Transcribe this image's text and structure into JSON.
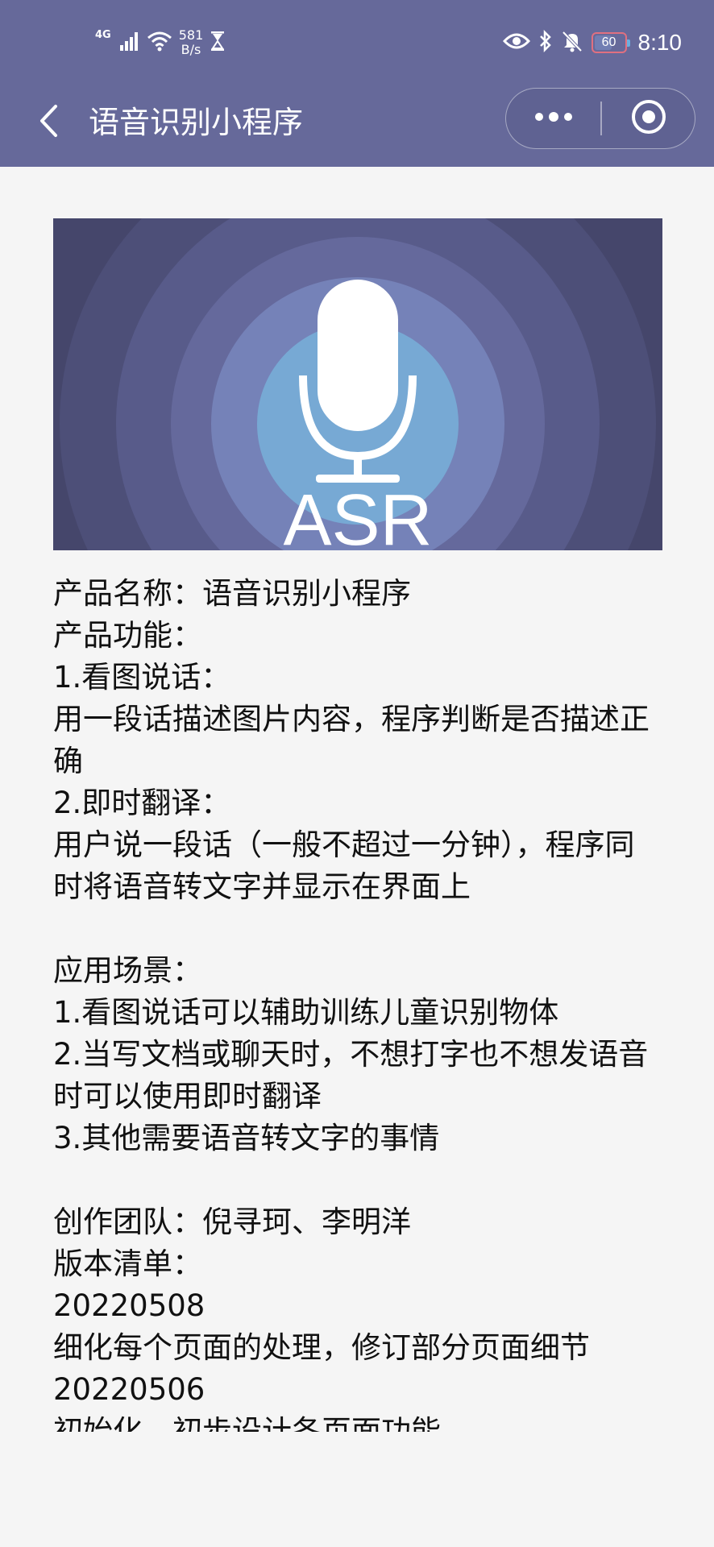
{
  "status_bar": {
    "network_type": "4G",
    "speed_value": "581",
    "speed_unit": "B/s",
    "battery": "60",
    "battery_level": 0.6,
    "time": "8:10"
  },
  "nav": {
    "title": "语音识别小程序"
  },
  "banner": {
    "text": "ASR"
  },
  "info": {
    "product_name": "产品名称：语音识别小程序",
    "product_function_heading": "产品功能：",
    "feature1_title": "1.看图说话：",
    "feature1_desc": "用一段话描述图片内容，程序判断是否描述正确",
    "feature2_title": "2.即时翻译：",
    "feature2_desc": "用户说一段话（一般不超过一分钟），程序同时将语音转文字并显示在界面上",
    "scenarios_heading": "应用场景：",
    "scenario1": "1.看图说话可以辅助训练儿童识别物体",
    "scenario2": "2.当写文档或聊天时，不想打字也不想发语音时可以使用即时翻译",
    "scenario3": "3.其他需要语音转文字的事情",
    "team": "创作团队：倪寻珂、李明洋",
    "versions_heading": "版本清单：",
    "version1_date": "20220508",
    "version1_desc": "细化每个页面的处理，修订部分页面细节",
    "version2_date": "20220506",
    "version2_desc": "初始化，初步设计各页面功能"
  },
  "colors": {
    "header_bg": "#66699a",
    "page_bg": "#f5f5f5",
    "banner_bg": "#45466b",
    "banner_center": "#78b0d8",
    "text": "#111111"
  }
}
